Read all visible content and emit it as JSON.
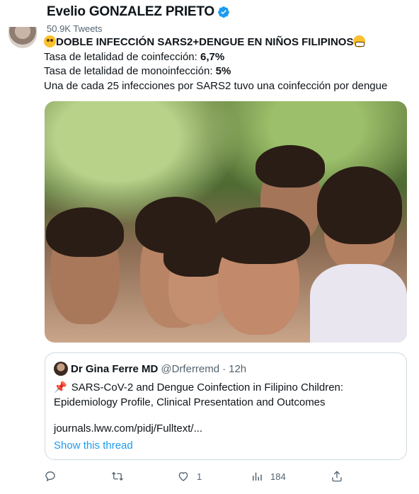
{
  "author": {
    "name": "Evelio GONZALEZ PRIETO",
    "verified": true,
    "tweets_count": "50.9K Tweets",
    "avatar_icon": "profile-photo"
  },
  "tweet": {
    "headline_emoji_start": "flushed-face",
    "headline": "DOBLE INFECCIÓN SARS2+DENGUE EN NIÑOS FILIPINOS",
    "headline_emoji_end": "grimacing-face",
    "line1_prefix": "Tasa de letalidad de coinfección: ",
    "line1_value": "6,7%",
    "line2_prefix": "Tasa de letalidad de monoinfección: ",
    "line2_value": "5%",
    "line3": "Una de cada 25 infecciones por SARS2 tuvo una coinfección por dengue"
  },
  "quoted": {
    "name": "Dr Gina Ferre MD",
    "handle": "@Drferremd",
    "separator": "·",
    "time": "12h",
    "pin_icon": "pushpin",
    "text_line1": "SARS-CoV-2 and Dengue Coinfection in Filipino Children:",
    "text_line2": "Epidemiology Profile, Clinical Presentation and Outcomes",
    "link": "journals.lww.com/pidj/Fulltext/...",
    "show_thread": "Show this thread"
  },
  "actions": {
    "reply_count": "",
    "retweet_count": "",
    "like_count": "1",
    "views_count": "184"
  },
  "colors": {
    "accent": "#1d9bf0",
    "secondary_text": "#536471",
    "border": "#cfd9de"
  }
}
